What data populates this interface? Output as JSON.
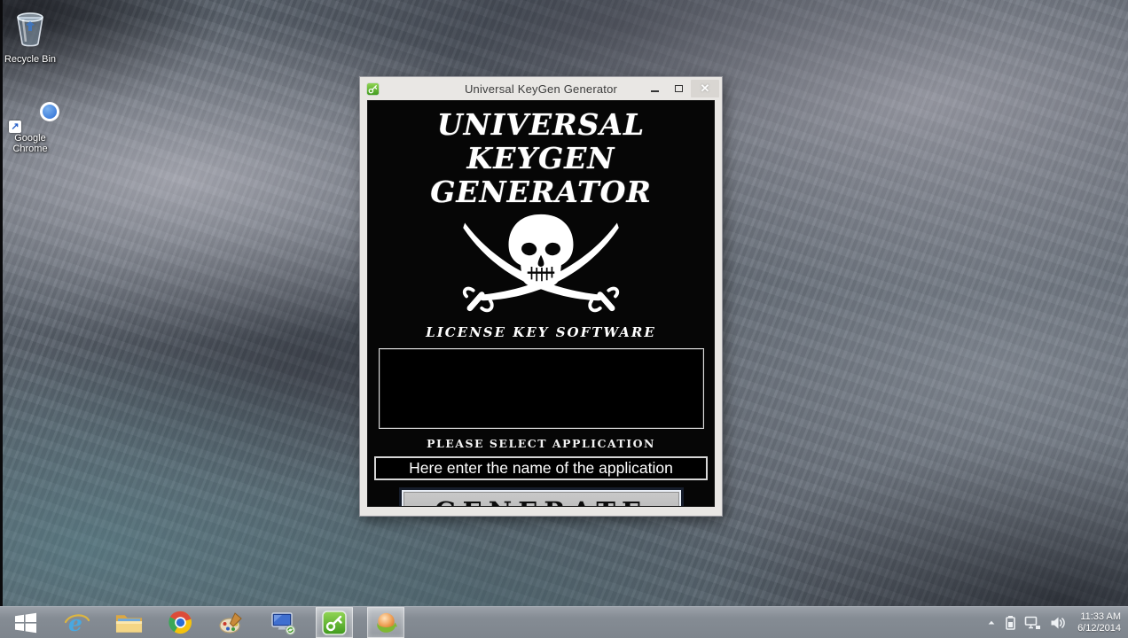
{
  "desktop": {
    "icons": [
      {
        "name": "recycle-bin",
        "label": "Recycle Bin"
      },
      {
        "name": "google-chrome",
        "label": "Google Chrome"
      }
    ]
  },
  "window": {
    "title": "Universal KeyGen Generator",
    "controls": {
      "close_glyph": "✕"
    },
    "heading_line1": "UNIVERSAL KEYGEN",
    "heading_line2": "GENERATOR",
    "logo_icon": "pirate-skull-crossed-swords",
    "tagline": "LICENSE KEY SOFTWARE",
    "select_label": "PLEASE SELECT APPLICATION",
    "input_value": "Here enter the name of the application",
    "generate_label": "GENERATE"
  },
  "taskbar": {
    "items": [
      {
        "name": "start-button",
        "icon": "windows-logo-icon",
        "active": false
      },
      {
        "name": "internet-explorer",
        "icon": "ie-icon",
        "active": false
      },
      {
        "name": "file-explorer",
        "icon": "folder-icon",
        "active": false
      },
      {
        "name": "chrome",
        "icon": "chrome-icon",
        "active": false
      },
      {
        "name": "paint",
        "icon": "paint-palette-icon",
        "active": false
      },
      {
        "name": "computer",
        "icon": "computer-icon",
        "active": false
      },
      {
        "name": "keygen-app",
        "icon": "keygen-key-icon",
        "active": true
      },
      {
        "name": "sphere-app",
        "icon": "orange-sphere-icon",
        "active": true
      }
    ],
    "tray": {
      "icons": [
        "hidden-icons-arrow",
        "battery-icon",
        "network-icon",
        "volume-icon"
      ],
      "time": "11:33 AM",
      "date": "6/12/2014"
    }
  },
  "colors": {
    "keygen_green": "#5cb82f",
    "taskbar_gray": "#868d95",
    "window_frame": "#e9e7e4",
    "button_gray": "#b9b9b9",
    "desktop_teal": "#4e6a70"
  }
}
